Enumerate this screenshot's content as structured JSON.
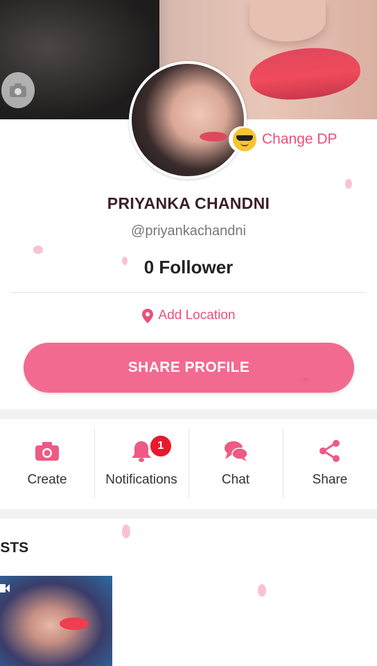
{
  "profile": {
    "change_dp_label": "Change DP",
    "name": "PRIYANKA CHANDNI",
    "handle": "@priyankachandni",
    "followers": "0 Follower",
    "location_label": "Add Location",
    "share_button": "SHARE PROFILE"
  },
  "actions": [
    {
      "label": "Create",
      "icon": "camera-icon"
    },
    {
      "label": "Notifications",
      "icon": "bell-icon",
      "badge": "1"
    },
    {
      "label": "Chat",
      "icon": "chat-icon"
    },
    {
      "label": "Share",
      "icon": "share-icon"
    }
  ],
  "posts": {
    "title": "OSTS"
  },
  "colors": {
    "accent": "#f26a90",
    "accent_text": "#e8527a",
    "badge": "#e8192c"
  }
}
